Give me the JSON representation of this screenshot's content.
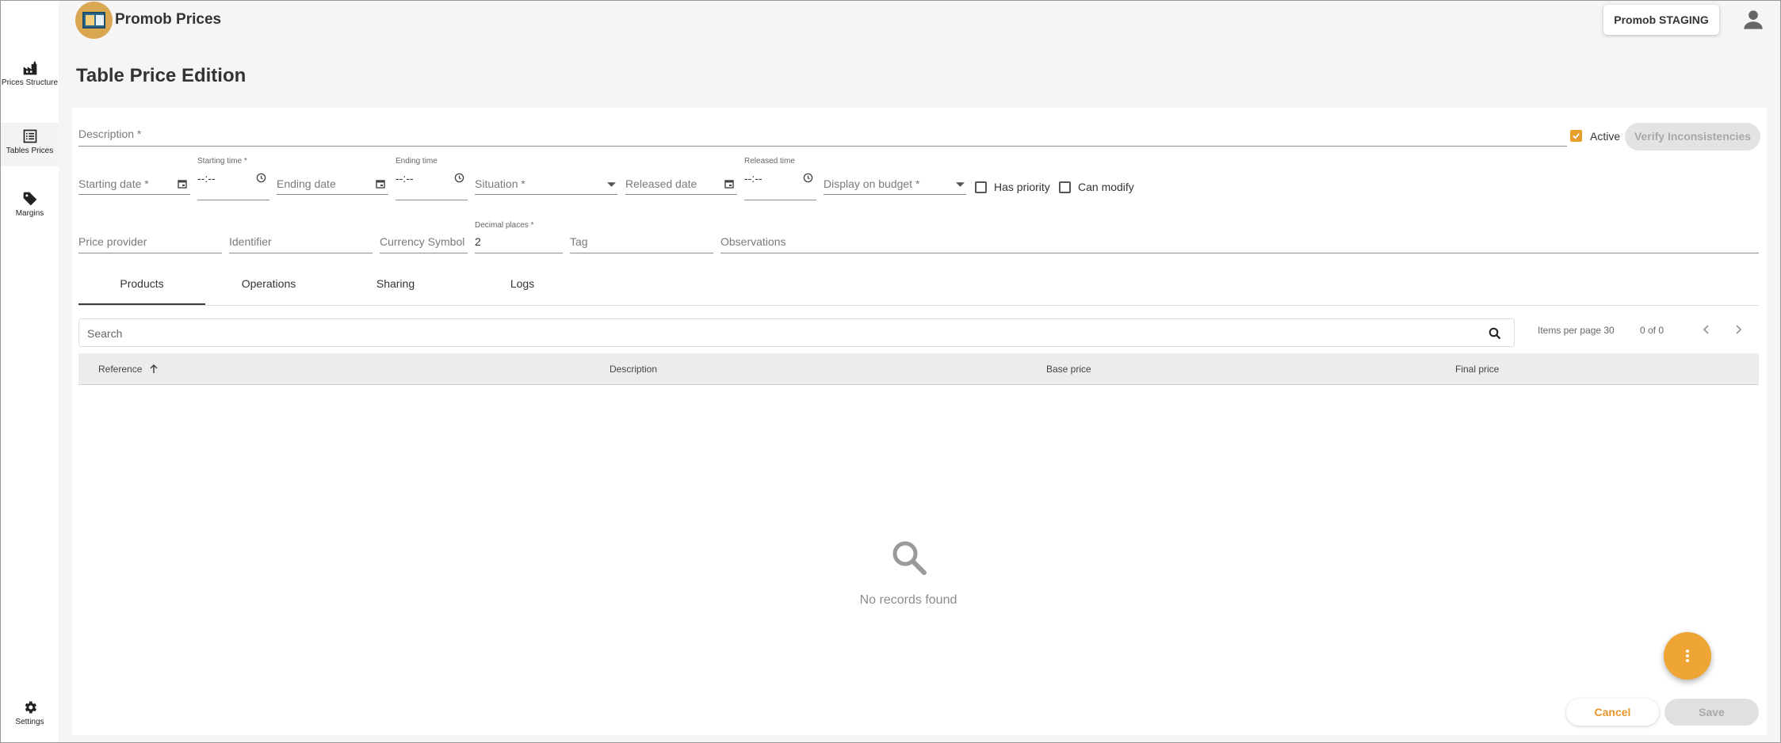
{
  "app": {
    "title": "Promob Prices",
    "environment": "Promob STAGING",
    "logo": "promob-logo"
  },
  "sidebar": {
    "items": [
      {
        "label": "Prices Structure",
        "icon": "factory-icon"
      },
      {
        "label": "Tables Prices",
        "icon": "table-list-icon",
        "active": true
      },
      {
        "label": "Margins",
        "icon": "tag-icon"
      },
      {
        "label": "Settings",
        "icon": "gear-icon"
      }
    ]
  },
  "page": {
    "title": "Table Price Edition"
  },
  "form": {
    "description": {
      "placeholder": "Description *",
      "value": ""
    },
    "active": {
      "label": "Active",
      "checked": true
    },
    "verify_label": "Verify Inconsistencies",
    "starting_date": {
      "placeholder": "Starting date *"
    },
    "starting_time": {
      "label": "Starting time *",
      "value": "--:--"
    },
    "ending_date": {
      "placeholder": "Ending date"
    },
    "ending_time": {
      "label": "Ending time",
      "value": "--:--"
    },
    "situation": {
      "placeholder": "Situation *"
    },
    "released_date": {
      "placeholder": "Released date"
    },
    "released_time": {
      "label": "Released time",
      "value": "--:--"
    },
    "display_on_budget": {
      "placeholder": "Display on budget *"
    },
    "has_priority": {
      "label": "Has priority",
      "checked": false
    },
    "can_modify": {
      "label": "Can modify",
      "checked": false
    },
    "price_provider": {
      "placeholder": "Price provider"
    },
    "identifier": {
      "placeholder": "Identifier"
    },
    "currency_symbol": {
      "placeholder": "Currency Symbol"
    },
    "decimal_places": {
      "label": "Decimal places *",
      "value": "2"
    },
    "tag": {
      "placeholder": "Tag"
    },
    "observations": {
      "placeholder": "Observations"
    }
  },
  "tabs": [
    "Products",
    "Operations",
    "Sharing",
    "Logs"
  ],
  "active_tab": "Products",
  "table": {
    "search_placeholder": "Search",
    "items_per_page": "Items per page 30",
    "range": "0 of 0",
    "columns": [
      "Reference",
      "Description",
      "Base price",
      "Final price"
    ],
    "sort_column": "Reference",
    "sort_direction": "asc",
    "empty_text": "No records found"
  },
  "actions": {
    "cancel": "Cancel",
    "save": "Save"
  },
  "colors": {
    "accent": "#eea533",
    "sidebar_bg": "#ffffff",
    "page_bg": "#f5f5f5"
  }
}
